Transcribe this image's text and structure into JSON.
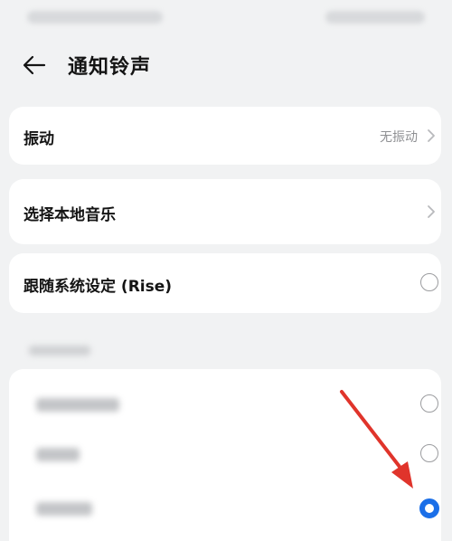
{
  "header": {
    "title": "通知铃声"
  },
  "vibration": {
    "label": "振动",
    "value": "无振动"
  },
  "local_music": {
    "label": "选择本地音乐"
  },
  "follow_system": {
    "label": "跟随系统设定 (Rise)"
  },
  "ringtones": {
    "selected_index": 2,
    "count": 3
  },
  "colors": {
    "accent": "#1b6fe8",
    "annotation_arrow": "#e0342b",
    "background": "#f1f2f3",
    "card": "#ffffff"
  },
  "icons": [
    "back-arrow-icon",
    "chevron-right-icon",
    "radio-icon",
    "annotation-arrow-icon"
  ]
}
